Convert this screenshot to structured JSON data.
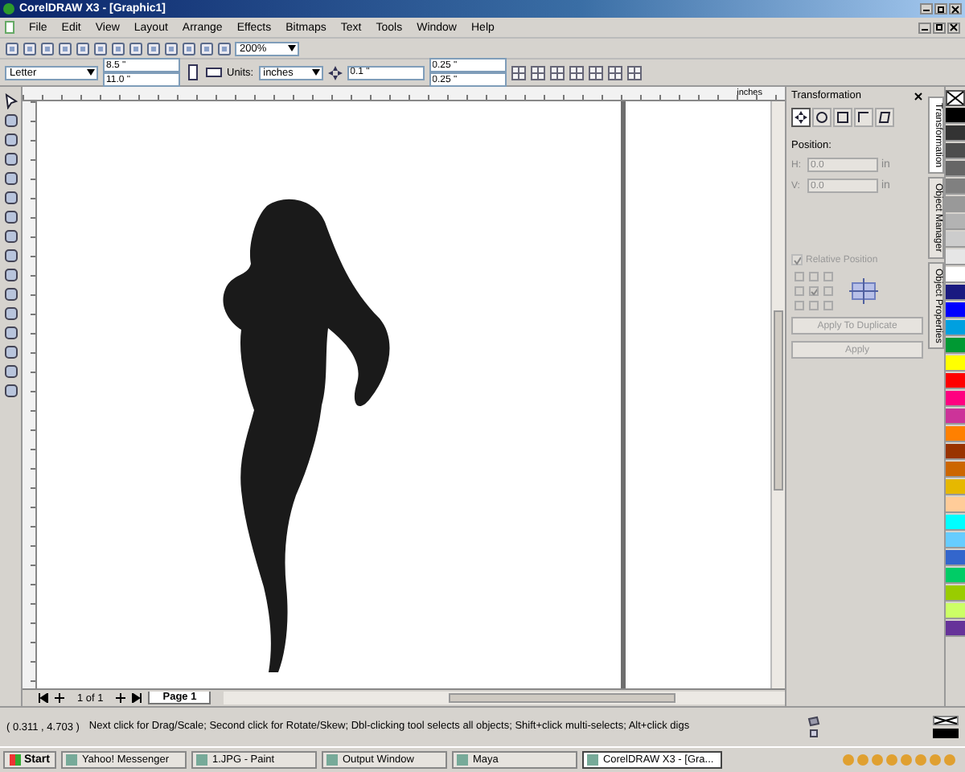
{
  "window": {
    "title": "CorelDRAW X3 - [Graphic1]"
  },
  "menu": [
    "File",
    "Edit",
    "View",
    "Layout",
    "Arrange",
    "Effects",
    "Bitmaps",
    "Text",
    "Tools",
    "Window",
    "Help"
  ],
  "standard_toolbar": {
    "zoom": "200%"
  },
  "property_bar": {
    "paper": "Letter",
    "width": "8.5 \"",
    "height": "11.0 \"",
    "units_label": "Units:",
    "units": "inches",
    "nudge": "0.1 \"",
    "duplicate_x": "0.25 \"",
    "duplicate_y": "0.25 \""
  },
  "ruler": {
    "unit": "inches"
  },
  "page_nav": {
    "counter": "1 of 1",
    "tabs": [
      {
        "label": "Page 1",
        "selected": true
      }
    ]
  },
  "docker": {
    "title": "Transformation",
    "modes": [
      {
        "kind": "position",
        "selected": true
      },
      {
        "kind": "rotate",
        "selected": false
      },
      {
        "kind": "scale",
        "selected": false
      },
      {
        "kind": "size",
        "selected": false
      },
      {
        "kind": "skew",
        "selected": false
      }
    ],
    "position_label": "Position:",
    "fields": [
      {
        "label": "H:",
        "value": "0.0",
        "unit": "in",
        "disabled": true
      },
      {
        "label": "V:",
        "value": "0.0",
        "unit": "in",
        "disabled": true
      }
    ],
    "relative_position": {
      "label": "Relative Position",
      "checked": true,
      "disabled": true
    },
    "anchors": [
      {
        "selected": false
      },
      {
        "selected": false
      },
      {
        "selected": false
      },
      {
        "selected": false
      },
      {
        "selected": true
      },
      {
        "selected": false
      },
      {
        "selected": false
      },
      {
        "selected": false
      },
      {
        "selected": false
      }
    ],
    "buttons": [
      {
        "label": "Apply To Duplicate",
        "disabled": true
      },
      {
        "label": "Apply",
        "disabled": true
      }
    ]
  },
  "docker_tabs": [
    {
      "label": "Transformation",
      "selected": true
    },
    {
      "label": "Object Manager",
      "selected": false
    },
    {
      "label": "Object Properties",
      "selected": false
    }
  ],
  "palette": [
    {
      "color": "#000000"
    },
    {
      "color": "#333333"
    },
    {
      "color": "#4d4d4d"
    },
    {
      "color": "#666666"
    },
    {
      "color": "#808080"
    },
    {
      "color": "#999999"
    },
    {
      "color": "#b3b3b3"
    },
    {
      "color": "#cccccc"
    },
    {
      "color": "#e6e6e6"
    },
    {
      "color": "#ffffff"
    },
    {
      "color": "#1a1a80"
    },
    {
      "color": "#0000ff"
    },
    {
      "color": "#00a0e0"
    },
    {
      "color": "#009933"
    },
    {
      "color": "#ffff00"
    },
    {
      "color": "#ff0000"
    },
    {
      "color": "#ff0080"
    },
    {
      "color": "#cc3399"
    },
    {
      "color": "#ff8000"
    },
    {
      "color": "#993300"
    },
    {
      "color": "#cc6600"
    },
    {
      "color": "#e6b800"
    },
    {
      "color": "#ffcc99"
    },
    {
      "color": "#00ffff"
    },
    {
      "color": "#66ccff"
    },
    {
      "color": "#3366cc"
    },
    {
      "color": "#00cc66"
    },
    {
      "color": "#99cc00"
    },
    {
      "color": "#ccff66"
    },
    {
      "color": "#663399"
    }
  ],
  "status_bar": {
    "coordinates": "( 0.311 , 4.703 )",
    "hint": "Next click for Drag/Scale; Second click for Rotate/Skew; Dbl-clicking tool selects all objects; Shift+click multi-selects; Alt+click digs"
  },
  "taskbar": {
    "start": "Start",
    "tasks": [
      {
        "label": "Yahoo! Messenger",
        "selected": false
      },
      {
        "label": "1.JPG - Paint",
        "selected": false
      },
      {
        "label": "Output Window",
        "selected": false
      },
      {
        "label": "Maya",
        "selected": false
      },
      {
        "label": "CorelDRAW X3 - [Gra...",
        "selected": true
      }
    ]
  }
}
